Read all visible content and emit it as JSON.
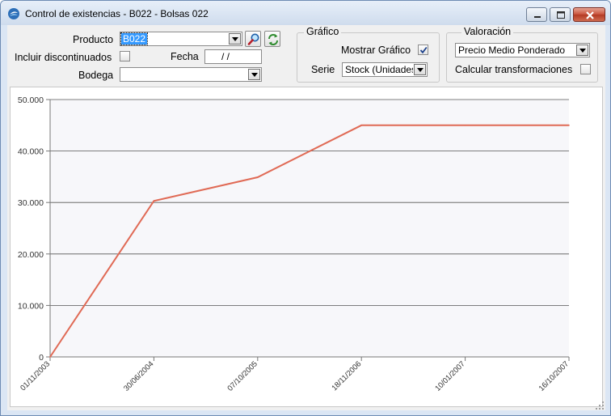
{
  "window": {
    "title": "Control de existencias  -  B022  -  Bolsas 022"
  },
  "form": {
    "producto_label": "Producto",
    "producto_value": "B022",
    "discontinuados_label": "Incluir discontinuados",
    "discontinuados_checked": false,
    "fecha_label": "Fecha",
    "fecha_value": "/  /",
    "bodega_label": "Bodega",
    "bodega_value": ""
  },
  "grafico": {
    "legend": "Gráfico",
    "mostrar_label": "Mostrar Gráfico",
    "mostrar_checked": true,
    "serie_label": "Serie",
    "serie_value": "Stock (Unidades)"
  },
  "valoracion": {
    "legend": "Valoración",
    "metodo_value": "Precio Medio Ponderado",
    "transformaciones_label": "Calcular transformaciones",
    "transformaciones_checked": false
  },
  "colors": {
    "line": "#e06a55",
    "plot_bg": "#f7f7fa",
    "grid": "#555555"
  },
  "chart_data": {
    "type": "line",
    "x": [
      "01/11/2003",
      "30/06/2004",
      "07/10/2005",
      "18/11/2006",
      "10/01/2007",
      "16/10/2007"
    ],
    "ylim": [
      0,
      50000
    ],
    "y_ticks": [
      0,
      10000,
      20000,
      30000,
      40000,
      50000
    ],
    "y_tick_labels": [
      "0",
      "10.000",
      "20.000",
      "30.000",
      "40.000",
      "50.000"
    ],
    "series": [
      {
        "values": [
          0,
          30300,
          34900,
          45000,
          45000,
          45000
        ]
      }
    ],
    "grid": true
  }
}
